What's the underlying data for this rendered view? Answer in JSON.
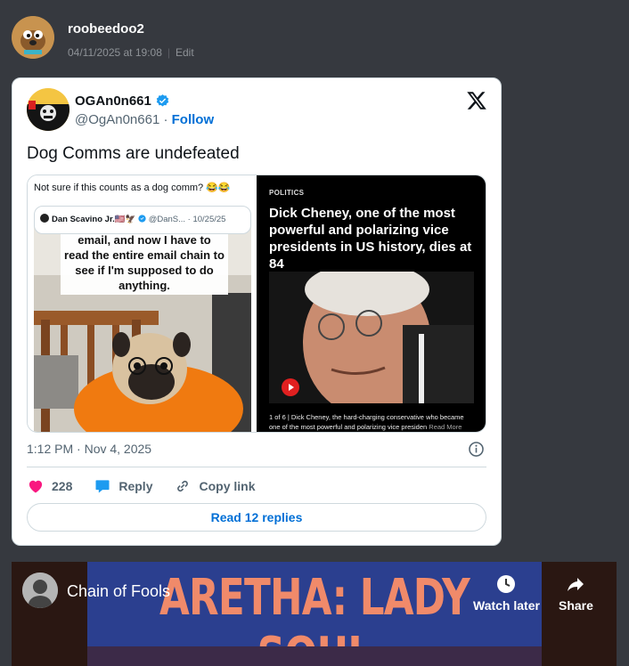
{
  "post": {
    "username": "roobeedoo2",
    "timestamp": "04/11/2025 at 19:08",
    "edit_label": "Edit"
  },
  "tweet": {
    "display_name": "OGAn0n661",
    "handle": "@OgAn0n661",
    "separator": " · ",
    "follow_label": "Follow",
    "text": "Dog Comms are undefeated",
    "time": "1:12 PM · Nov 4, 2025",
    "likes": "228",
    "reply_label": "Reply",
    "copy_link_label": "Copy link",
    "read_replies_label": "Read 12 replies",
    "media_left": {
      "caption": "Not sure if this counts as a dog comm? 😂😂",
      "quote_name": "Dan Scavino Jr.🇺🇸🦅",
      "quote_handle": "@DanS...",
      "quote_date": "· 10/25/25",
      "overlay_text": "email, and now I have to read the entire email chain to see if I'm supposed to do anything."
    },
    "media_right": {
      "section": "POLITICS",
      "headline": "Dick Cheney, one of the most powerful and polarizing vice presidents in US history, dies at 84",
      "caption": "1 of 6 | Dick Cheney, the hard-charging conservative who became one of the most powerful and polarizing vice presiden",
      "more_label": "Read More"
    }
  },
  "video": {
    "title": "Chain of Fools",
    "thumbnail_text": "ARETHA: LADY SOUL",
    "watch_later_label": "Watch later",
    "share_label": "Share"
  },
  "colors": {
    "background": "#36393f",
    "link_blue": "#006fd6",
    "like_pink": "#f91880",
    "verified_blue": "#1d9bf0",
    "youtube_red": "#e02020"
  },
  "icons": [
    "x-logo-icon",
    "verified-icon",
    "info-icon",
    "heart-icon",
    "reply-bubble-icon",
    "link-icon",
    "play-icon",
    "clock-icon",
    "share-arrow-icon"
  ]
}
